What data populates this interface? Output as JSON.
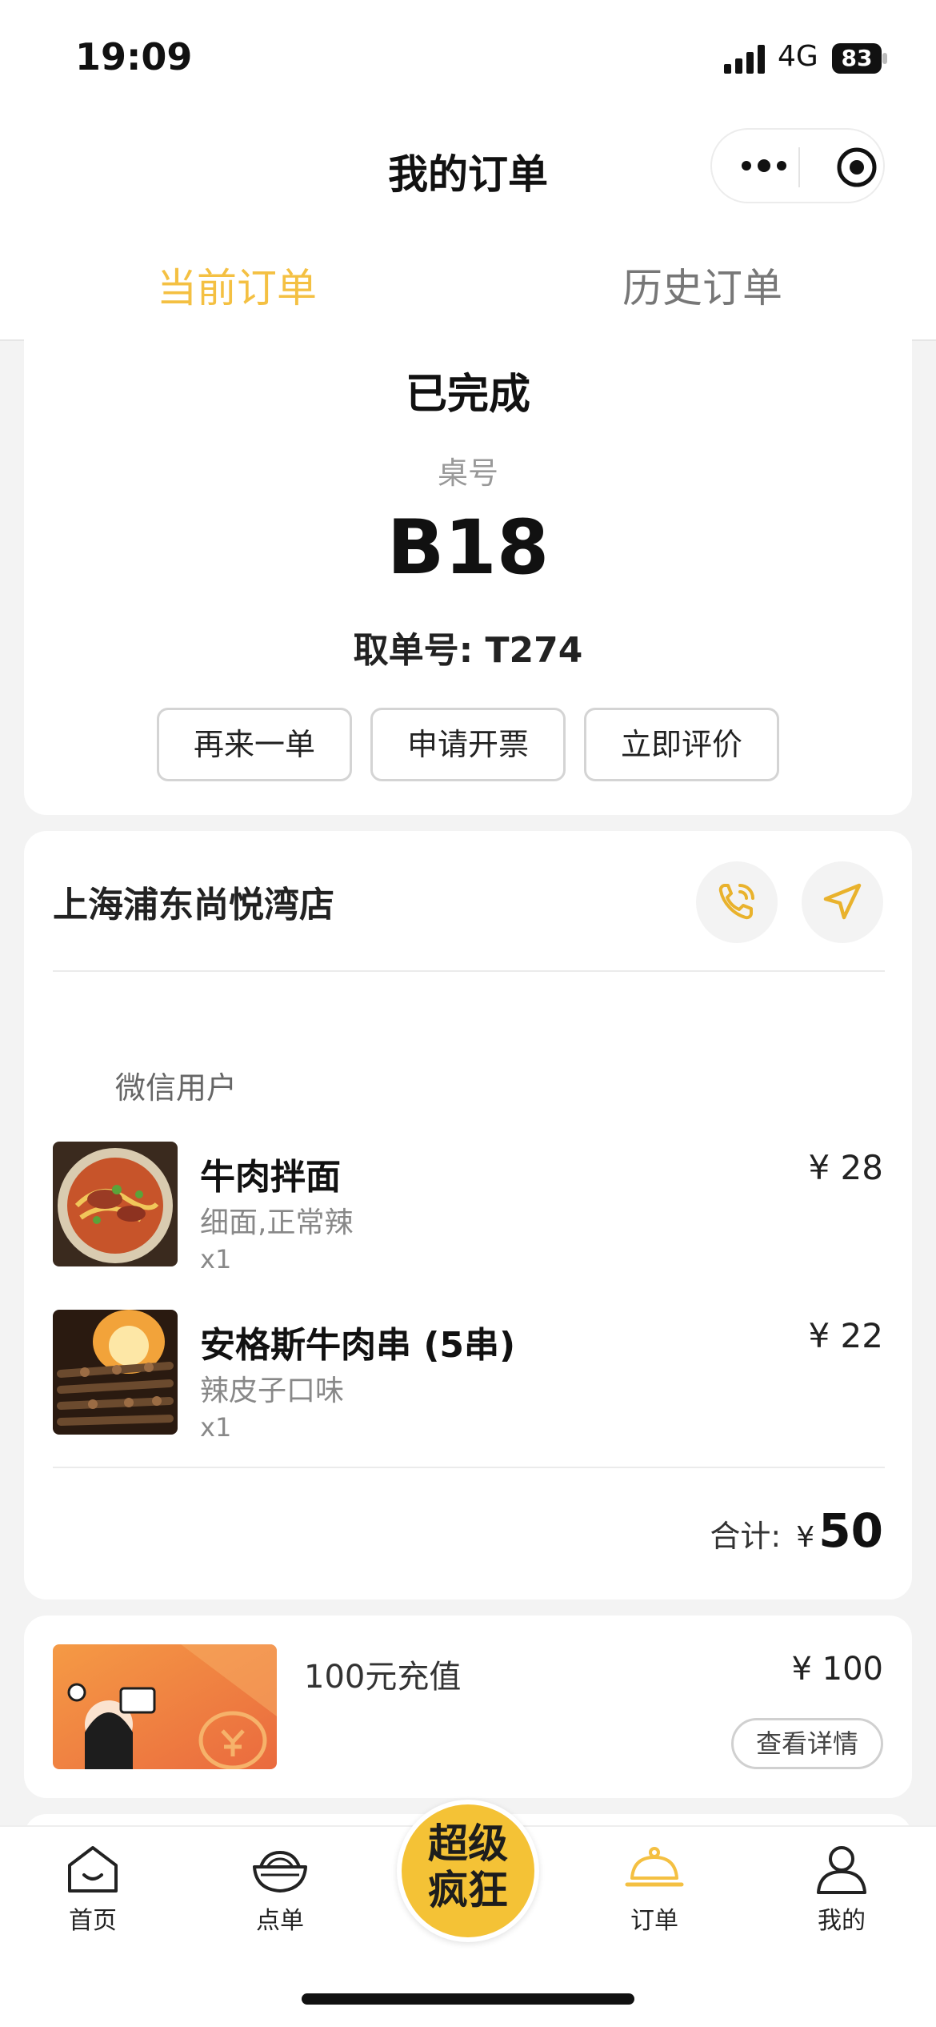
{
  "status_bar": {
    "time": "19:09",
    "network": "4G",
    "battery": "83"
  },
  "nav": {
    "title": "我的订单"
  },
  "tabs": {
    "current": "当前订单",
    "history": "历史订单"
  },
  "order": {
    "status": "已完成",
    "table_label": "桌号",
    "table_number": "B18",
    "pickup_label": "取单号: T274",
    "actions": {
      "reorder": "再来一单",
      "invoice": "申请开票",
      "review": "立即评价"
    }
  },
  "store": {
    "name": "上海浦东尚悦湾店",
    "orderer": "微信用户",
    "items": [
      {
        "name": "牛肉拌面",
        "spec": "细面,正常辣",
        "qty": "x1",
        "price": "¥ 28"
      },
      {
        "name": "安格斯牛肉串 (5串)",
        "spec": "辣皮子口味",
        "qty": "x1",
        "price": "¥ 22"
      }
    ],
    "total_label": "合计:",
    "total_currency": "¥",
    "total_value": "50"
  },
  "recharge": {
    "title": "100元充值",
    "price": "¥ 100",
    "detail_button": "查看详情"
  },
  "tabbar": {
    "home": "首页",
    "menu": "点单",
    "promo_line1": "超级",
    "promo_line2": "疯狂",
    "order": "订单",
    "mine": "我的"
  },
  "colors": {
    "accent": "#f4c042",
    "background": "#f3f3f3"
  }
}
